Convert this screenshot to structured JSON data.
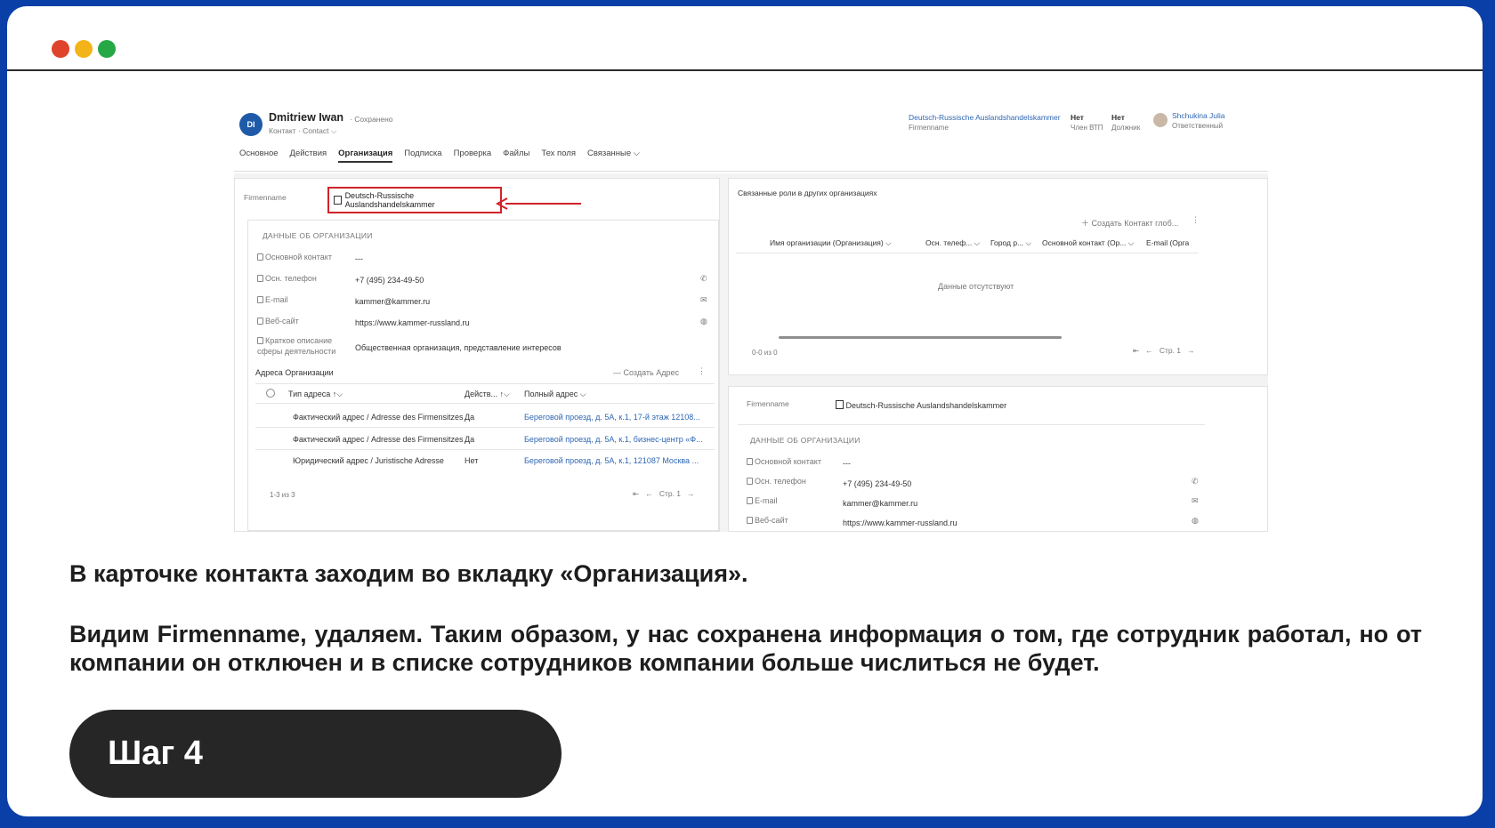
{
  "window": {
    "dots": [
      "#e0432b",
      "#f2b418",
      "#27a846"
    ]
  },
  "screenshot": {
    "header": {
      "avatar_initials": "DI",
      "name": "Dmitriew Iwan",
      "saved": "· Сохранено",
      "entity": "Контакт · Contact ⌵",
      "right_company": "Deutsch-Russische Auslandshandelskammer",
      "right_company_label": "Firmenname",
      "f1_value": "Нет",
      "f1_label": "Член ВТП",
      "f2_value": "Нет",
      "f2_label": "Должник",
      "owner_name": "Shchukina Julia",
      "owner_label": "Ответственный"
    },
    "tabs": [
      {
        "label": "Основное"
      },
      {
        "label": "Действия"
      },
      {
        "label": "Организация",
        "active": true
      },
      {
        "label": "Подписка"
      },
      {
        "label": "Проверка"
      },
      {
        "label": "Файлы"
      },
      {
        "label": "Тех поля"
      },
      {
        "label": "Связанные ⌵"
      }
    ],
    "left": {
      "firmenname_label": "Firmenname",
      "firmenname_value": "Deutsch-Russische Auslandshandelskammer",
      "org_section": "ДАННЫЕ ОБ ОРГАНИЗАЦИИ",
      "fields": [
        {
          "label": "Основной контакт",
          "value": "---"
        },
        {
          "label": "Осн. телефон",
          "value": "+7 (495) 234-49-50"
        },
        {
          "label": "E-mail",
          "value": "kammer@kammer.ru"
        },
        {
          "label": "Веб-сайт",
          "value": "https://www.kammer-russland.ru"
        },
        {
          "label": "Краткое описание сферы деятельности",
          "value": "Общественная организация, представление интересов"
        }
      ],
      "addresses_title": "Адреса Организации",
      "create_address": "Создать Адрес",
      "columns": [
        "Тип адреса ↑⌵",
        "Действ... ↑⌵",
        "Полный адрес ⌵"
      ],
      "rows": [
        {
          "type": "Фактический адрес / Adresse des Firmensitzes",
          "active": "Да",
          "address": "Береговой проезд, д. 5А, к.1, 17-й этаж 12108..."
        },
        {
          "type": "Фактический адрес / Adresse des Firmensitzes",
          "active": "Да",
          "address": "Береговой проезд, д. 5А, к.1, бизнес-центр «Ф..."
        },
        {
          "type": "Юридический адрес / Juristische Adresse",
          "active": "Нет",
          "address": "Береговой проезд, д. 5А, к.1, 121087 Москва ..."
        }
      ],
      "count": "1-3 из 3",
      "page": "Стр. 1"
    },
    "right": {
      "roles_title": "Связанные роли в других организациях",
      "create_contact": "Создать Контакт глоб...",
      "columns": [
        "Имя организации (Организация) ⌵",
        "Осн. телеф... ⌵",
        "Город р... ⌵",
        "Основной контакт (Ор... ⌵",
        "E-mail (Орга"
      ],
      "empty": "Данные отсутствуют",
      "count": "0-0 из 0",
      "page": "Стр. 1",
      "firmenname_label": "Firmenname",
      "firmenname_value": "Deutsch-Russische Auslandshandelskammer",
      "org_section": "ДАННЫЕ ОБ ОРГАНИЗАЦИИ",
      "fields": [
        {
          "label": "Основной контакт",
          "value": "---"
        },
        {
          "label": "Осн. телефон",
          "value": "+7 (495) 234-49-50"
        },
        {
          "label": "E-mail",
          "value": "kammer@kammer.ru"
        },
        {
          "label": "Веб-сайт",
          "value": "https://www.kammer-russland.ru"
        }
      ]
    }
  },
  "text": {
    "para1": "В карточке контакта заходим во вкладку «Организация».",
    "para2": "Видим Firmenname, удаляем. Таким образом, у нас сохранена информация о том, где сотрудник работал, но от компании он отключен и в списке сотрудников компании больше числиться не будет."
  },
  "step": {
    "label": "Шаг 4"
  }
}
